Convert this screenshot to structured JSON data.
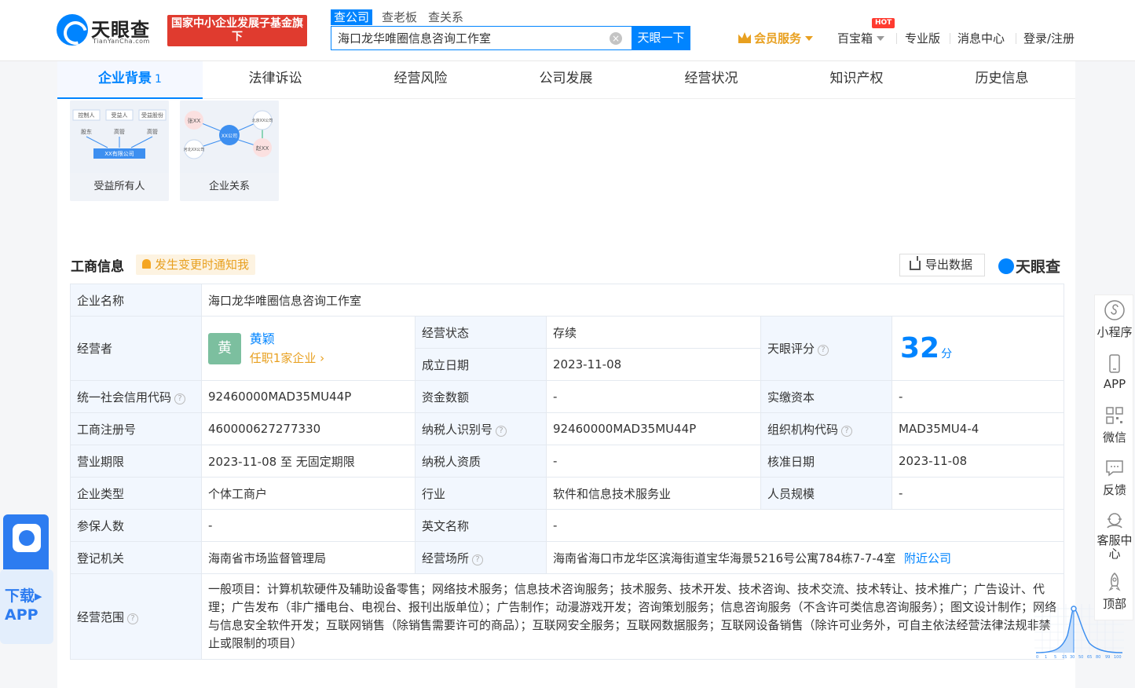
{
  "header": {
    "logo_text": "天眼查",
    "logo_sub": "TianYanCha.com",
    "gov_badge": "国家中小企业发展子基金旗下",
    "search_tabs": [
      "查公司",
      "查老板",
      "查关系"
    ],
    "search_value": "海口龙华唯圈信息咨询工作室",
    "search_button": "天眼一下",
    "vip": "会员服务",
    "baibao": "百宝箱",
    "hot": "HOT",
    "pro": "专业版",
    "messages": "消息中心",
    "login": "登录/注册"
  },
  "tabs": [
    {
      "label": "企业背景",
      "count": "1"
    },
    {
      "label": "法律诉讼"
    },
    {
      "label": "经营风险"
    },
    {
      "label": "公司发展"
    },
    {
      "label": "经营状况"
    },
    {
      "label": "知识产权"
    },
    {
      "label": "历史信息"
    }
  ],
  "cards": [
    {
      "label": "受益所有人",
      "diagram_top": [
        "控制人",
        "受益人",
        "受益股份"
      ],
      "diagram_mid": [
        "股东",
        "高管",
        "高管"
      ],
      "diagram_bottom": "XX有限公司"
    },
    {
      "label": "企业关系",
      "nodes": [
        "张XX",
        "XX公司",
        "北京XX公司",
        "河北XX公司",
        "赵XX"
      ]
    }
  ],
  "section": {
    "title": "工商信息",
    "notify": "发生变更时通知我",
    "export": "导出数据",
    "brand": "天眼查"
  },
  "info": {
    "company_name_k": "企业名称",
    "company_name_v": "海口龙华唯圈信息咨询工作室",
    "operator_k": "经营者",
    "operator_avatar": "黄",
    "operator_name": "黄颖",
    "operator_link": "任职1家企业",
    "status_k": "经营状态",
    "status_v": "存续",
    "founded_k": "成立日期",
    "founded_v": "2023-11-08",
    "score_k": "天眼评分",
    "score_v": "32",
    "score_unit": "分",
    "score_axis": [
      "0",
      "1",
      "5",
      "15",
      "30",
      "50",
      "65",
      "80",
      "99",
      "100"
    ],
    "credit_code_k": "统一社会信用代码",
    "credit_code_v": "92460000MAD35MU44P",
    "capital_k": "资金数额",
    "capital_v": "-",
    "paid_k": "实缴资本",
    "paid_v": "-",
    "reg_no_k": "工商注册号",
    "reg_no_v": "460000627277330",
    "tax_id_k": "纳税人识别号",
    "tax_id_v": "92460000MAD35MU44P",
    "org_code_k": "组织机构代码",
    "org_code_v": "MAD35MU4-4",
    "term_k": "营业期限",
    "term_v": "2023-11-08 至 无固定期限",
    "tax_qual_k": "纳税人资质",
    "tax_qual_v": "-",
    "approve_k": "核准日期",
    "approve_v": "2023-11-08",
    "type_k": "企业类型",
    "type_v": "个体工商户",
    "industry_k": "行业",
    "industry_v": "软件和信息技术服务业",
    "staff_k": "人员规模",
    "staff_v": "-",
    "insured_k": "参保人数",
    "insured_v": "-",
    "en_name_k": "英文名称",
    "en_name_v": "-",
    "authority_k": "登记机关",
    "authority_v": "海南省市场监督管理局",
    "address_k": "经营场所",
    "address_v": "海南省海口市龙华区滨海街道宝华海景5216号公寓784栋7-7-4室",
    "nearby": "附近公司",
    "scope_k": "经营范围",
    "scope_v": "一般项目：计算机软硬件及辅助设备零售；网络技术服务；信息技术咨询服务；技术服务、技术开发、技术咨询、技术交流、技术转让、技术推广；广告设计、代理；广告发布（非广播电台、电视台、报刊出版单位）；广告制作；动漫游戏开发；咨询策划服务；信息咨询服务（不含许可类信息咨询服务）；图文设计制作；网络与信息安全软件开发；互联网销售（除销售需要许可的商品）；互联网安全服务；互联网数据服务；互联网设备销售（除许可业务外，可自主依法经营法律法规非禁止或限制的项目）"
  },
  "right_toolbar": [
    "小程序",
    "APP",
    "微信",
    "反馈",
    "客服中心",
    "顶部"
  ],
  "download_app": "下载▸APP",
  "colors": {
    "brand": "#0084ff",
    "status_green": "#2bb673",
    "orange": "#e8a020",
    "gov_red": "#e03b2f"
  }
}
